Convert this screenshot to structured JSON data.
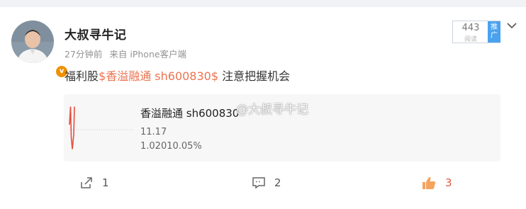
{
  "post": {
    "author_name": "大叔寻牛记",
    "verified_badge": "v",
    "time": "27分钟前",
    "source": "来自 iPhone客户端",
    "read_count": "443",
    "read_label": "阅读",
    "promote_label": "推广",
    "content_prefix": "福利股",
    "content_tag": "$香溢融通 sh600830$",
    "content_suffix": " 注意把握机会"
  },
  "stock_card": {
    "title": "香溢融通 sh600830",
    "price": "11.17",
    "change": "1.02010.05%"
  },
  "watermark": "@大叔寻牛记",
  "actions": {
    "share_count": "1",
    "comment_count": "2",
    "like_count": "3"
  },
  "chart_data": {
    "type": "line",
    "values": [
      10.8,
      11.17,
      10.55,
      10.3,
      10.6,
      11.17
    ],
    "baseline": 10.15
  },
  "colors": {
    "accent": "#eb7350",
    "like": "#e0583c",
    "promote": "#4aa2ef",
    "badge": "#f09000"
  }
}
